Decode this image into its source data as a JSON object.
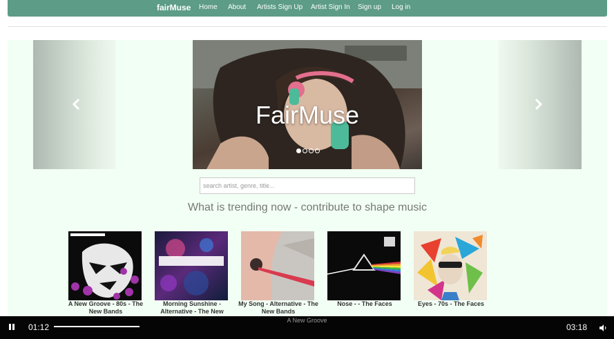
{
  "nav": {
    "brand": "fairMuse",
    "links": [
      "Home",
      "About",
      "Artists Sign Up",
      "Artist Sign In",
      "Sign up",
      "Log in"
    ]
  },
  "carousel": {
    "caption": "FairMuse",
    "prev_icon": "chevron-left-icon",
    "next_icon": "chevron-right-icon",
    "active_index": 0,
    "slide_count": 4
  },
  "search": {
    "placeholder": "search artist, genre, title..."
  },
  "trending": {
    "heading": "What is trending now - contribute to shape music",
    "albums": [
      {
        "title": "A New Groove - 80s - The New Bands"
      },
      {
        "title": "Morning Sunshine - Alternative - The New Bands"
      },
      {
        "title": "My Song - Alternative - The New Bands"
      },
      {
        "title": "Nose - - The Faces"
      },
      {
        "title": "Eyes - 70s - The Faces"
      }
    ]
  },
  "player": {
    "current_time": "01:12",
    "total_time": "03:18",
    "track_name": "A New Groove",
    "pause_icon": "pause-icon",
    "volume_icon": "volume-icon"
  },
  "colors": {
    "navbar": "#5d9c87",
    "section_bg": "#f2fff4",
    "player_bg": "#050505"
  }
}
